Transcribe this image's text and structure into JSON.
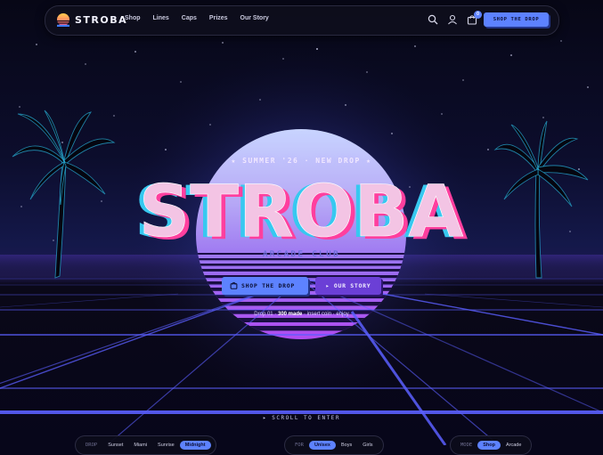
{
  "brand": {
    "name": "STROBA"
  },
  "nav": {
    "links": [
      "Shop",
      "Lines",
      "Caps",
      "Prizes",
      "Our Story"
    ],
    "cart_count": "0",
    "cta": "SHOP THE DROP",
    "icons": [
      "search-icon",
      "user-icon",
      "bag-icon"
    ]
  },
  "hero": {
    "eyebrow": "★ SUMMER '26 · NEW DROP ★",
    "title": "STROBA",
    "subtitle": "ARCADE CLUB",
    "cta_primary": "SHOP THE DROP",
    "cta_secondary": "▸ OUR STORY",
    "meta_pre": "Drop 01 ·",
    "meta_count": "300 made",
    "meta_post": "· insert coin · enjoy",
    "scroll_hint": "▸ SCROLL TO ENTER"
  },
  "filters": [
    {
      "label": "DROP",
      "options": [
        "Sunset",
        "Miami",
        "Sunrise",
        "Midnight"
      ],
      "active": "Midnight"
    },
    {
      "label": "FOR",
      "options": [
        "Unisex",
        "Boys",
        "Girls"
      ],
      "active": "Unisex"
    },
    {
      "label": "MODE",
      "options": [
        "Shop",
        "Arcade"
      ],
      "active": "Shop"
    }
  ],
  "colors": {
    "accent": "#5d82ff",
    "secondary": "#6b3fd6",
    "title_fill": "#f3c4e4",
    "title_cyan": "#37c8f0",
    "title_magenta": "#ff3f9e",
    "grid": "#5b5fff"
  }
}
